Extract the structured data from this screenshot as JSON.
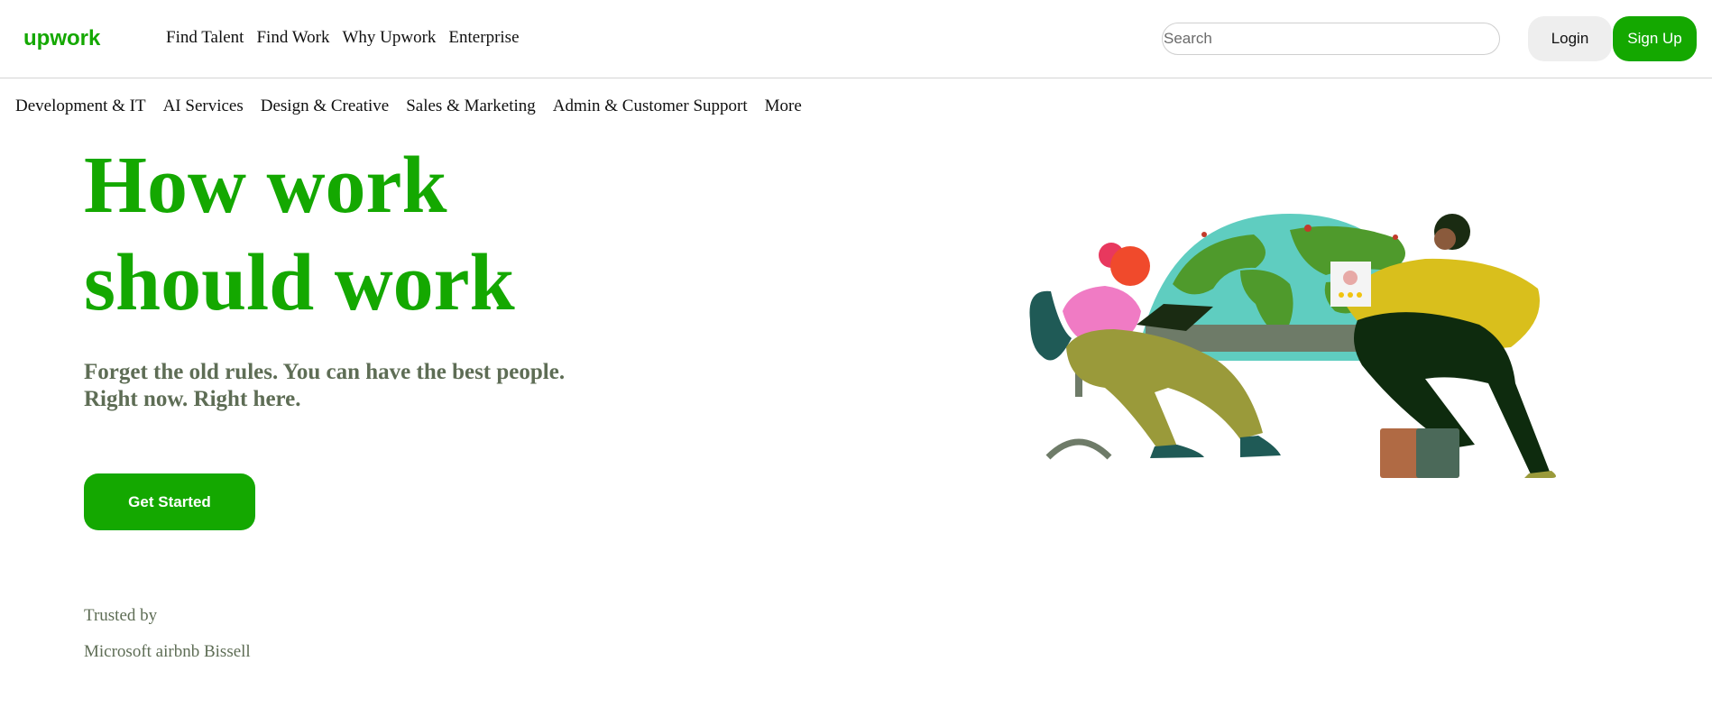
{
  "brand": {
    "logo_text": "upwork",
    "accent": "#14a800",
    "muted_text": "#5e6d55"
  },
  "topnav": {
    "items": [
      {
        "label": "Find Talent"
      },
      {
        "label": "Find Work"
      },
      {
        "label": "Why Upwork"
      },
      {
        "label": "Enterprise"
      }
    ]
  },
  "search": {
    "placeholder": "Search",
    "value": ""
  },
  "auth": {
    "login_label": "Login",
    "signup_label": "Sign Up"
  },
  "categories": {
    "items": [
      {
        "label": "Development & IT"
      },
      {
        "label": "AI Services"
      },
      {
        "label": "Design & Creative"
      },
      {
        "label": "Sales & Marketing"
      },
      {
        "label": "Admin & Customer Support"
      },
      {
        "label": "More"
      }
    ]
  },
  "hero": {
    "title_line1": "How work",
    "title_line2": "should work",
    "subtitle_line1": "Forget the old rules. You can have the best people.",
    "subtitle_line2": "Right now. Right here.",
    "cta_label": "Get Started",
    "illustration": "two-people-at-globe-illustration"
  },
  "trusted": {
    "label": "Trusted by",
    "logos": "Microsoft airbnb Bissell"
  }
}
